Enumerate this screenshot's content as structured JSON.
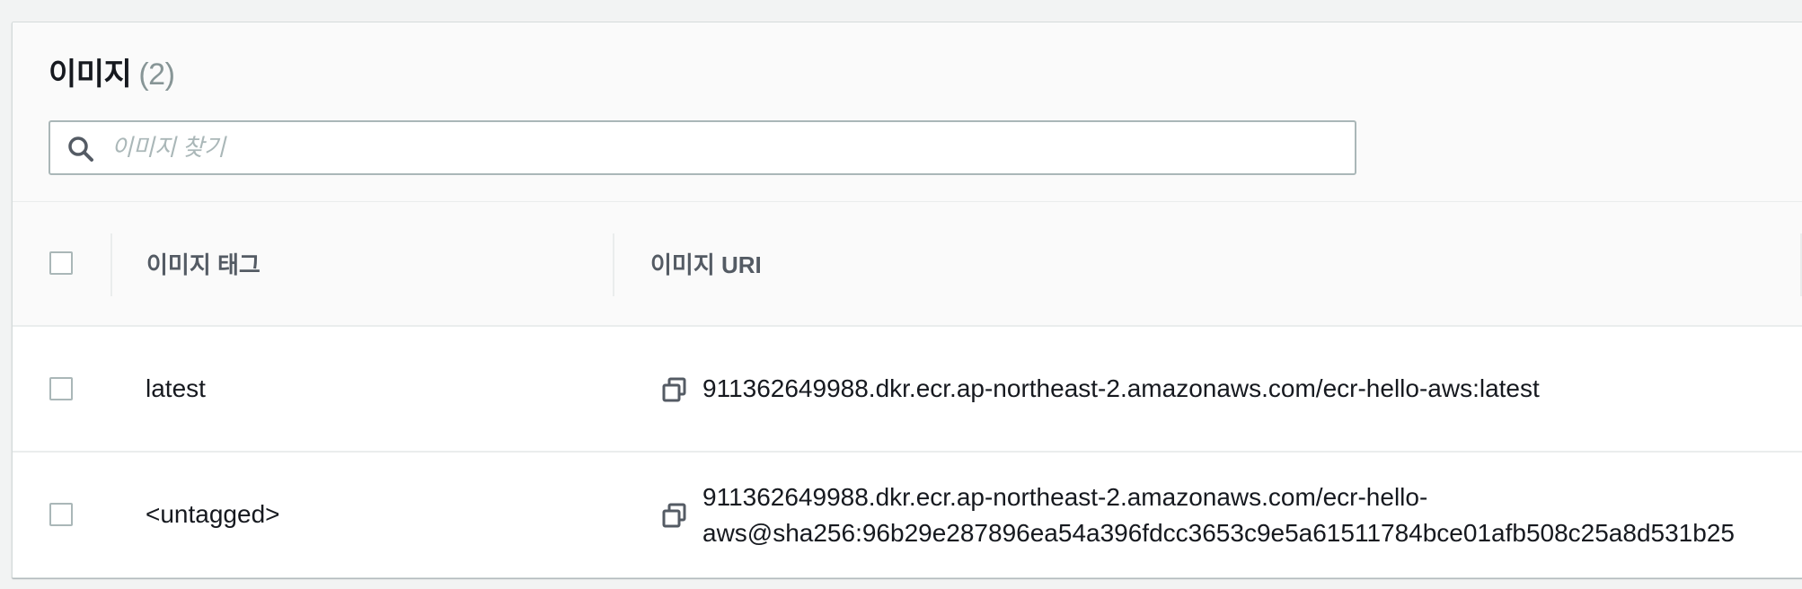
{
  "images_panel": {
    "title": "이미지",
    "count": "(2)",
    "search": {
      "placeholder": "이미지 찾기",
      "value": "",
      "icon": "search-icon"
    }
  },
  "table": {
    "columns": [
      {
        "label": "이미지 태그"
      },
      {
        "label": "이미지 URI"
      }
    ],
    "rows": [
      {
        "tag": "latest",
        "uri": "911362649988.dkr.ecr.ap-northeast-2.amazonaws.com/ecr-hello-aws:latest",
        "selected": false
      },
      {
        "tag": "<untagged>",
        "uri_line1": "911362649988.dkr.ecr.ap-northeast-2.amazonaws.com/ecr-hello-",
        "uri_line2": "aws@sha256:96b29e287896ea54a396fdcc3653c9e5a61511784bce01afb508c25a8d531b25",
        "selected": false
      }
    ]
  },
  "colors": {
    "header_bg": "#fafafa",
    "border": "#eaeded",
    "muted_text": "#879596",
    "placeholder": "#aab7b8",
    "text": "#16191f"
  }
}
